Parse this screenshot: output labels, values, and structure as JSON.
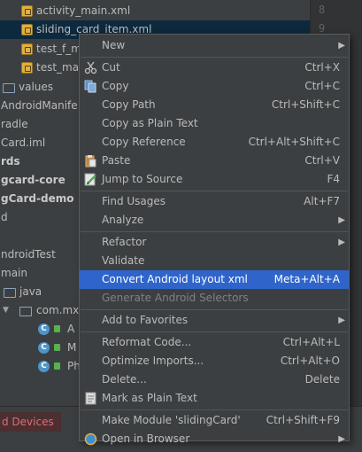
{
  "tree": {
    "items": [
      {
        "label": "activity_main.xml"
      },
      {
        "label": "sliding_card_item.xml"
      },
      {
        "label": "test_f_ma"
      },
      {
        "label": "test_mai"
      },
      {
        "label": "values"
      },
      {
        "label": "AndroidManife"
      },
      {
        "label": "radle"
      },
      {
        "label": "Card.iml"
      },
      {
        "label": "rds"
      },
      {
        "label": "gcard-core"
      },
      {
        "label": "gCard-demo"
      },
      {
        "label": "d"
      },
      {
        "label": "ndroidTest"
      },
      {
        "label": "main"
      },
      {
        "label": "java"
      },
      {
        "label": "com.mxn"
      },
      {
        "label": "A"
      },
      {
        "label": "M"
      },
      {
        "label": "Ph"
      }
    ],
    "class_icon_letter": "C"
  },
  "gutter": {
    "line_numbers": [
      "8",
      "9"
    ]
  },
  "bottom": {
    "devices_tab": "d Devices"
  },
  "menu": {
    "new": "New",
    "cut": "Cut",
    "cut_sc": "Ctrl+X",
    "copy": "Copy",
    "copy_sc": "Ctrl+C",
    "copy_path": "Copy Path",
    "copy_path_sc": "Ctrl+Shift+C",
    "copy_plain": "Copy as Plain Text",
    "copy_ref": "Copy Reference",
    "copy_ref_sc": "Ctrl+Alt+Shift+C",
    "paste": "Paste",
    "paste_sc": "Ctrl+V",
    "jump": "Jump to Source",
    "jump_sc": "F4",
    "find_usages": "Find Usages",
    "find_usages_sc": "Alt+F7",
    "analyze": "Analyze",
    "refactor": "Refactor",
    "validate": "Validate",
    "convert": "Convert Android layout xml",
    "convert_sc": "Meta+Alt+A",
    "generate": "Generate Android Selectors",
    "favorites": "Add to Favorites",
    "reformat": "Reformat Code...",
    "reformat_sc": "Ctrl+Alt+L",
    "optimize": "Optimize Imports...",
    "optimize_sc": "Ctrl+Alt+O",
    "delete": "Delete...",
    "delete_sc": "Delete",
    "mark_plain": "Mark as Plain Text",
    "make_module": "Make Module 'slidingCard'",
    "make_module_sc": "Ctrl+Shift+F9",
    "open_browser": "Open in Browser"
  },
  "colors": {
    "highlight": "#2f65ca",
    "background": "#3c3f41",
    "text": "#bbbbbb",
    "disabled": "#808080"
  }
}
